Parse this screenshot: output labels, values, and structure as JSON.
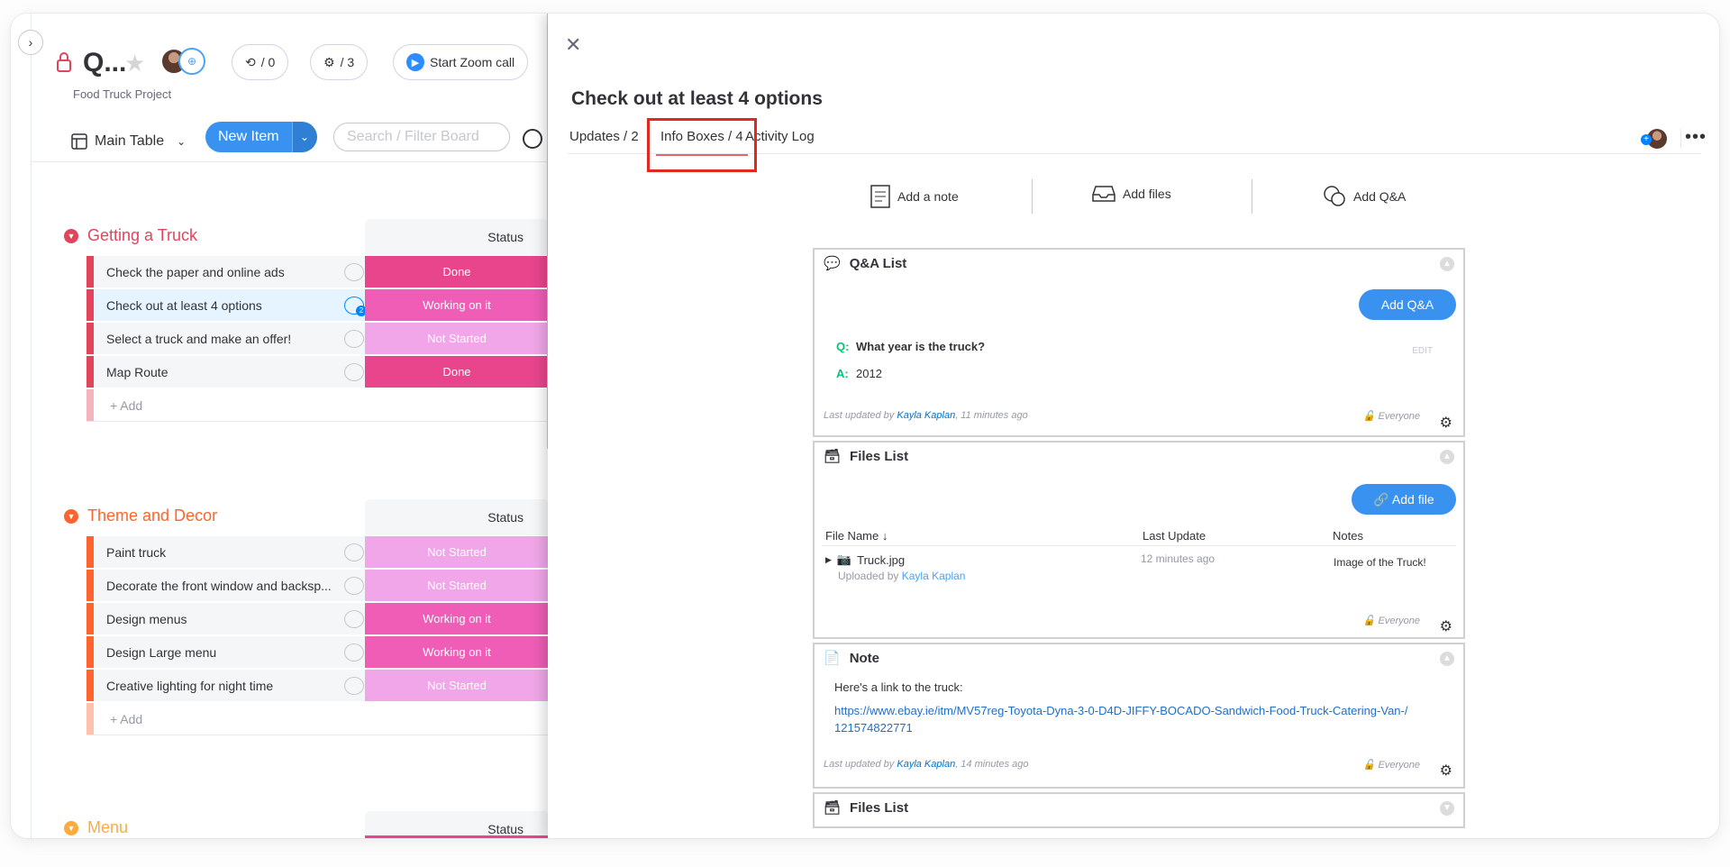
{
  "board": {
    "title": "Q...",
    "subtitle": "Food Truck Project",
    "updates_count": "/ 0",
    "automations_count": "/ 3",
    "zoom_label": "Start Zoom call",
    "view_label": "Main Table",
    "new_item_label": "New Item",
    "search_placeholder": "Search / Filter Board",
    "status_header": "Status",
    "add_label": "+ Add",
    "groups": [
      {
        "title": "Getting a Truck",
        "color": "#e2445c",
        "items": [
          {
            "name": "Check the paper and online ads",
            "status": "Done",
            "status_color": "#e8458c"
          },
          {
            "name": "Check out at least 4 options",
            "status": "Working on it",
            "status_color": "#ef5db6",
            "comments": "2"
          },
          {
            "name": "Select a truck and make an offer!",
            "status": "Not Started",
            "status_color": "#f0a6e8"
          },
          {
            "name": "Map Route",
            "status": "Done",
            "status_color": "#e8458c"
          }
        ]
      },
      {
        "title": "Theme and Decor",
        "color": "#ff642e",
        "items": [
          {
            "name": "Paint truck",
            "status": "Not Started",
            "status_color": "#f0a6e8"
          },
          {
            "name": "Decorate the front window and backsp...",
            "status": "Not Started",
            "status_color": "#f0a6e8"
          },
          {
            "name": "Design menus",
            "status": "Working on it",
            "status_color": "#ef5db6"
          },
          {
            "name": "Design Large menu",
            "status": "Working on it",
            "status_color": "#ef5db6"
          },
          {
            "name": "Creative lighting for night time",
            "status": "Not Started",
            "status_color": "#f0a6e8"
          }
        ]
      },
      {
        "title": "Menu",
        "color": "#fdab3d",
        "items": []
      }
    ]
  },
  "panel": {
    "title": "Check out at least 4 options",
    "tabs": [
      "Updates / 2",
      "Info Boxes / 4",
      "Activity Log"
    ],
    "actions": [
      "Add a note",
      "Add files",
      "Add Q&A"
    ],
    "qa": {
      "title": "Q&A List",
      "add_label": "Add Q&A",
      "q_prefix": "Q:",
      "question": "What year is the truck?",
      "edit_label": "EDIT",
      "a_prefix": "A:",
      "answer": "2012",
      "meta_prefix": "Last updated by",
      "author": "Kayla Kaplan",
      "time": ", 11 minutes ago",
      "visibility": "Everyone"
    },
    "files": {
      "title": "Files List",
      "add_label": "Add file",
      "col_name": "File Name ↓",
      "col_update": "Last Update",
      "col_notes": "Notes",
      "file_name": "Truck.jpg",
      "uploaded_prefix": "Uploaded by",
      "uploader": "Kayla Kaplan",
      "file_time": "12 minutes ago",
      "file_note": "Image of the Truck!",
      "visibility": "Everyone"
    },
    "note": {
      "title": "Note",
      "text": "Here's a link to the truck:",
      "link": "https://www.ebay.ie/itm/MV57reg-Toyota-Dyna-3-0-D4D-JIFFY-BOCADO-Sandwich-Food-Truck-Catering-Van-/121574822771",
      "meta_prefix": "Last updated by",
      "author": "Kayla Kaplan",
      "time": ", 14 minutes ago",
      "visibility": "Everyone"
    },
    "files2": {
      "title": "Files List"
    }
  }
}
